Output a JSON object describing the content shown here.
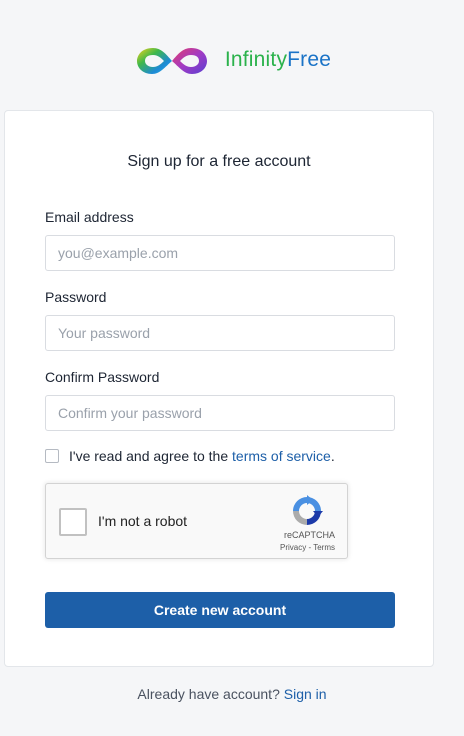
{
  "brand": {
    "name_part1": "Infinity",
    "name_part2": "Free",
    "logo_icon": "infinity-logo-icon",
    "colors": {
      "part1": "#2bb24c",
      "part2": "#1a73c7"
    }
  },
  "form": {
    "title": "Sign up for a free account",
    "email": {
      "label": "Email address",
      "placeholder": "you@example.com",
      "value": ""
    },
    "password": {
      "label": "Password",
      "placeholder": "Your password",
      "value": ""
    },
    "confirm_password": {
      "label": "Confirm Password",
      "placeholder": "Confirm your password",
      "value": ""
    },
    "terms": {
      "checked": false,
      "text_before": "I've read and agree to the ",
      "link_text": "terms of service",
      "text_after": "."
    },
    "recaptcha": {
      "label": "I'm not a robot",
      "brand": "reCAPTCHA",
      "privacy": "Privacy",
      "separator": " - ",
      "terms": "Terms",
      "icon": "recaptcha-logo-icon"
    },
    "submit_label": "Create new account"
  },
  "footer": {
    "text": "Already have account? ",
    "link_text": "Sign in"
  },
  "colors": {
    "primary": "#1d5fa8",
    "background": "#f5f6f8",
    "card": "#ffffff"
  }
}
